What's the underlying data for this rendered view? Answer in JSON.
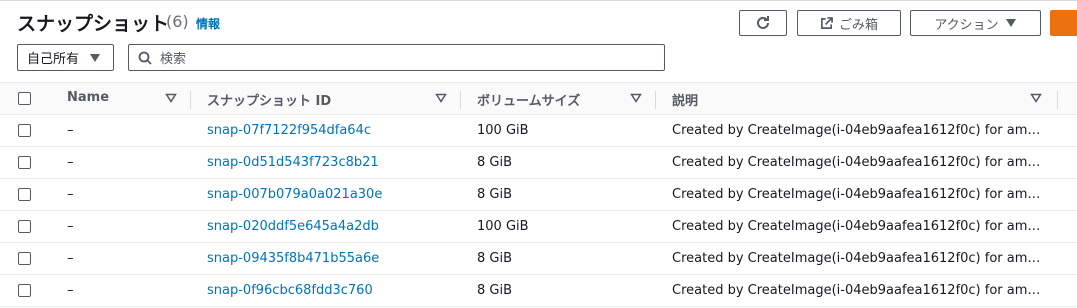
{
  "header": {
    "title": "スナップショット",
    "count": "(6)",
    "info": "情報",
    "open_label": "ごみ箱",
    "actions_label": "アクション"
  },
  "filters": {
    "owner_select": "自己所有",
    "search_placeholder": "検索"
  },
  "table": {
    "columns": [
      "Name",
      "スナップショット ID",
      "ボリュームサイズ",
      "説明"
    ],
    "rows": [
      {
        "name": "–",
        "id": "snap-07f7122f954dfa64c",
        "size": "100 GiB",
        "desc": "Created by CreateImage(i-04eb9aafea1612f0c) for ami-..."
      },
      {
        "name": "–",
        "id": "snap-0d51d543f723c8b21",
        "size": "8 GiB",
        "desc": "Created by CreateImage(i-04eb9aafea1612f0c) for ami-..."
      },
      {
        "name": "–",
        "id": "snap-007b079a0a021a30e",
        "size": "8 GiB",
        "desc": "Created by CreateImage(i-04eb9aafea1612f0c) for ami-..."
      },
      {
        "name": "–",
        "id": "snap-020ddf5e645a4a2db",
        "size": "100 GiB",
        "desc": "Created by CreateImage(i-04eb9aafea1612f0c) for ami-..."
      },
      {
        "name": "–",
        "id": "snap-09435f8b471b55a6e",
        "size": "8 GiB",
        "desc": "Created by CreateImage(i-04eb9aafea1612f0c) for ami-..."
      },
      {
        "name": "–",
        "id": "snap-0f96cbc68fdd3c760",
        "size": "8 GiB",
        "desc": "Created by CreateImage(i-04eb9aafea1612f0c) for ami-..."
      }
    ]
  },
  "colors": {
    "link": "#0073bb",
    "primary": "#ec7211"
  },
  "icons": {
    "refresh": "refresh-icon",
    "external": "external-link-icon",
    "caret": "caret-down-icon",
    "search": "search-icon",
    "sort": "sort-icon"
  }
}
